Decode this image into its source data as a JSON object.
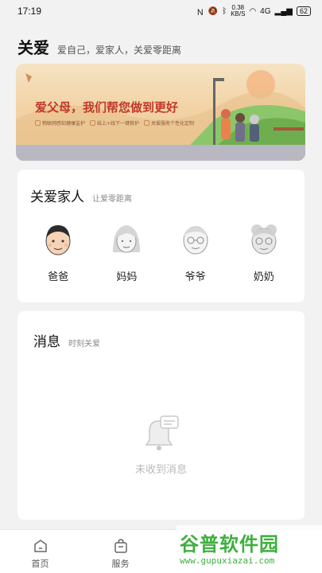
{
  "status": {
    "time": "17:19",
    "net_speed": "0.38",
    "net_unit": "KB/S",
    "battery": "62",
    "signal": "4G"
  },
  "header": {
    "title": "关爱",
    "subtitle": "爱自己，爱家人，关爱零距离"
  },
  "banner": {
    "headline": "爱父母，我们帮您做到更好",
    "tags": [
      "物联网感知健康监护",
      "线上+线下一键救护",
      "关爱服务个性化定制"
    ],
    "colors": {
      "sky": "#f6e3c4",
      "headline": "#c0392b"
    }
  },
  "family": {
    "title": "关爱家人",
    "subtitle": "让爱零距离",
    "members": [
      {
        "name": "爸爸",
        "icon": "father-avatar"
      },
      {
        "name": "妈妈",
        "icon": "mother-avatar"
      },
      {
        "name": "爷爷",
        "icon": "grandfather-avatar"
      },
      {
        "name": "奶奶",
        "icon": "grandmother-avatar"
      }
    ]
  },
  "messages": {
    "title": "消息",
    "subtitle": "时刻关爱",
    "empty_text": "未收到消息",
    "empty_icon": "bell-message-icon"
  },
  "tabbar": {
    "tabs": [
      {
        "label": "首页",
        "icon": "home-icon"
      },
      {
        "label": "服务",
        "icon": "service-bag-icon"
      }
    ]
  },
  "watermark": {
    "text": "谷普软件园",
    "url": "www.gupuxiazai.com"
  }
}
